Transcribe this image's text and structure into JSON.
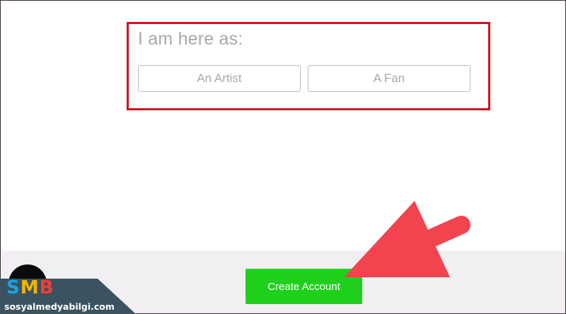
{
  "role_selection": {
    "prompt": "I am here as:",
    "options": [
      {
        "label": "An Artist"
      },
      {
        "label": "A Fan"
      }
    ]
  },
  "actions": {
    "create_account_label": "Create Account"
  },
  "annotation": {
    "highlight_color": "#d0101e",
    "arrow_color": "#f2444f",
    "arrow_target": "create-account-button"
  },
  "watermark": {
    "brand": "SMB",
    "brand_letters": [
      "S",
      "M",
      "B"
    ],
    "url": "sosyalmedyabilgi.com",
    "colors": {
      "s": "#1aa3e8",
      "m": "#f4b400",
      "b": "#ef3f35",
      "banner": "#3b5360"
    }
  },
  "colors": {
    "create_button": "#1fd11c",
    "footer_band": "#f1eff2"
  }
}
